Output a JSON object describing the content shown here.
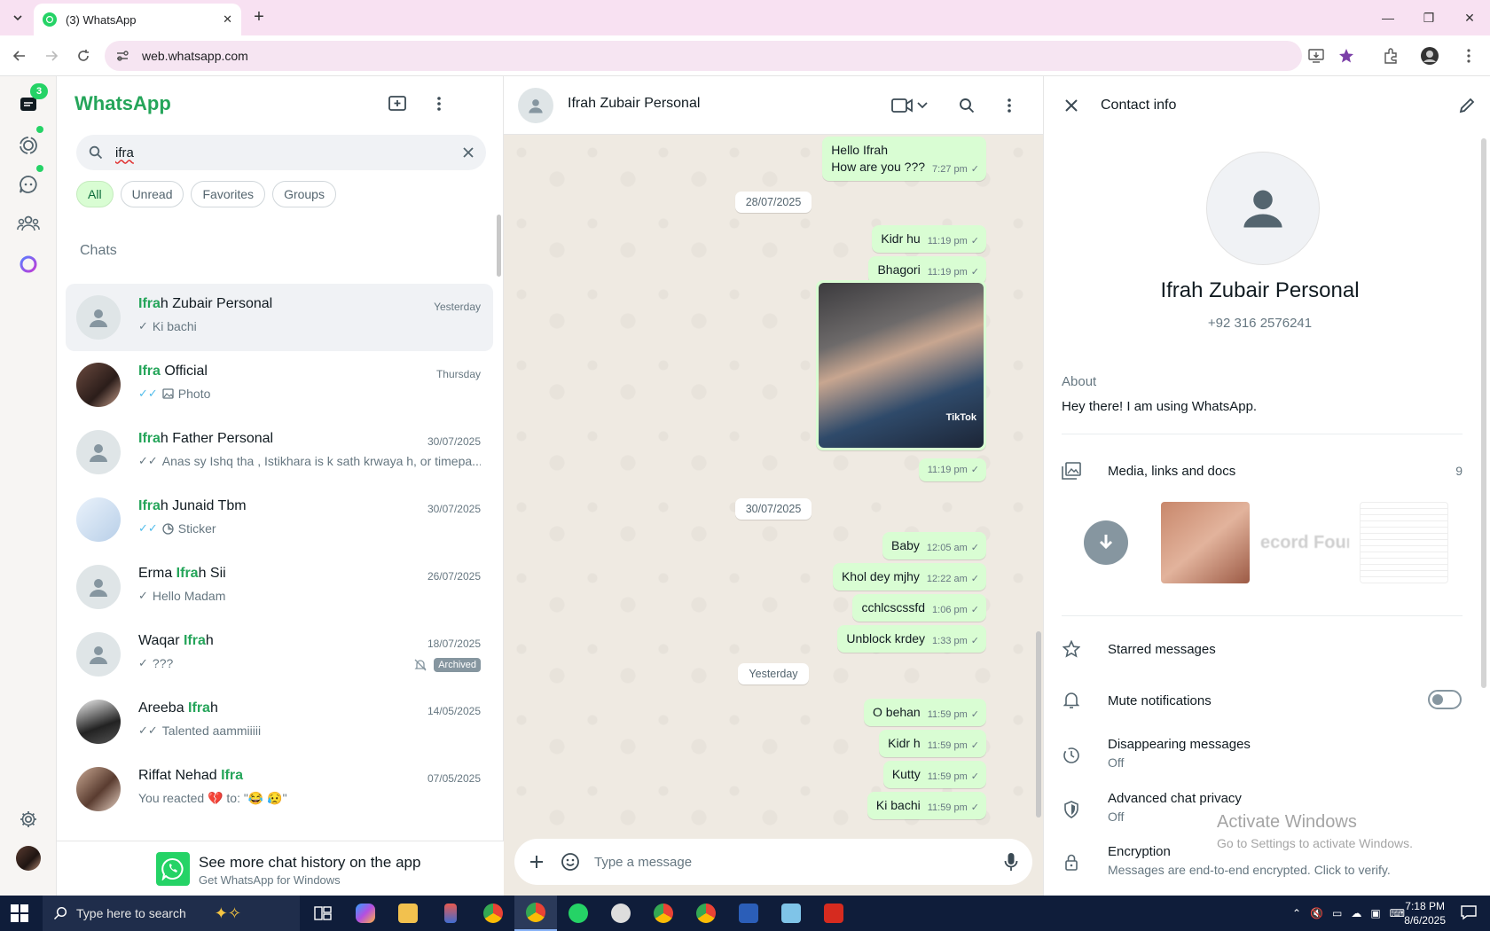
{
  "browser": {
    "tab_title": "(3) WhatsApp",
    "url": "web.whatsapp.com"
  },
  "rail": {
    "chats_badge": "3"
  },
  "sidebar": {
    "brand": "WhatsApp",
    "search_value": "ifra",
    "filters": [
      "All",
      "Unread",
      "Favorites",
      "Groups"
    ],
    "section_label": "Chats",
    "chats": [
      {
        "pre": "",
        "hl": "Ifra",
        "post": "h Zubair Personal",
        "time": "Yesterday",
        "msg": "Ki bachi",
        "tick": "✓",
        "tick_color": "grey"
      },
      {
        "pre": "",
        "hl": "Ifra",
        "post": " Official",
        "time": "Thursday",
        "msg": "Photo",
        "tick": "✓✓",
        "tick_color": "blue"
      },
      {
        "pre": "",
        "hl": "Ifra",
        "post": "h Father Personal",
        "time": "30/07/2025",
        "msg": "Anas sy Ishq tha , Istikhara is k sath krwaya h, or timepa...",
        "tick": "✓✓",
        "tick_color": "grey"
      },
      {
        "pre": "",
        "hl": "Ifra",
        "post": "h Junaid Tbm",
        "time": "30/07/2025",
        "msg": "Sticker",
        "tick": "✓✓",
        "tick_color": "blue"
      },
      {
        "pre": "Erma ",
        "hl": "Ifra",
        "post": "h Sii",
        "time": "26/07/2025",
        "msg": "Hello Madam",
        "tick": "✓",
        "tick_color": "grey"
      },
      {
        "pre": "Waqar ",
        "hl": "Ifra",
        "post": "h",
        "time": "18/07/2025",
        "msg": "???",
        "tick": "✓",
        "tick_color": "grey",
        "badge": "Archived"
      },
      {
        "pre": "Areeba ",
        "hl": "Ifra",
        "post": "h",
        "time": "14/05/2025",
        "msg": "Talented aammiiiii",
        "tick": "✓✓",
        "tick_color": "grey"
      },
      {
        "pre": "Riffat Nehad ",
        "hl": "Ifra",
        "post": "",
        "time": "07/05/2025",
        "msg": "You reacted 💔 to: \"😂 😥\"",
        "tick": "",
        "tick_color": "grey"
      }
    ],
    "promo_title": "See more chat history on the app",
    "promo_sub": "Get WhatsApp for Windows"
  },
  "conversation": {
    "contact_name": "Ifrah Zubair Personal",
    "messages": [
      {
        "kind": "text",
        "lines": [
          "Hello Ifrah",
          "How are you ???"
        ],
        "time": "7:27 pm"
      },
      {
        "kind": "date",
        "text": "28/07/2025"
      },
      {
        "kind": "text",
        "lines": [
          "Kidr hu"
        ],
        "time": "11:19 pm"
      },
      {
        "kind": "text",
        "lines": [
          "Bhagori"
        ],
        "time": "11:19 pm"
      },
      {
        "kind": "media",
        "caption": "TikTok",
        "time": "11:19 pm"
      },
      {
        "kind": "date",
        "text": "30/07/2025"
      },
      {
        "kind": "text",
        "lines": [
          "Baby"
        ],
        "time": "12:05 am"
      },
      {
        "kind": "text",
        "lines": [
          "Khol dey mjhy"
        ],
        "time": "12:22 am"
      },
      {
        "kind": "text",
        "lines": [
          "cchlcscssfd"
        ],
        "time": "1:06 pm"
      },
      {
        "kind": "text",
        "lines": [
          "Unblock krdey"
        ],
        "time": "1:33 pm"
      },
      {
        "kind": "date",
        "text": "Yesterday"
      },
      {
        "kind": "text",
        "lines": [
          "O behan"
        ],
        "time": "11:59 pm"
      },
      {
        "kind": "text",
        "lines": [
          "Kidr h"
        ],
        "time": "11:59 pm"
      },
      {
        "kind": "text",
        "lines": [
          "Kutty"
        ],
        "time": "11:59 pm"
      },
      {
        "kind": "text",
        "lines": [
          "Ki bachi"
        ],
        "time": "11:59 pm"
      }
    ],
    "compose_placeholder": "Type a message"
  },
  "contact_info": {
    "title": "Contact info",
    "name": "Ifrah Zubair Personal",
    "phone": "+92 316 2576241",
    "about_label": "About",
    "about_value": "Hey there! I am using WhatsApp.",
    "media_label": "Media, links and docs",
    "media_count": "9",
    "media_thumb_text": "ecord Foun",
    "starred_label": "Starred messages",
    "mute_label": "Mute notifications",
    "mute_on": false,
    "disappearing_label": "Disappearing messages",
    "disappearing_value": "Off",
    "privacy_label": "Advanced chat privacy",
    "privacy_value": "Off",
    "encryption_label": "Encryption",
    "encryption_value": "Messages are end-to-end encrypted. Click to verify."
  },
  "watermark": {
    "line1": "Activate Windows",
    "line2": "Go to Settings to activate Windows."
  },
  "taskbar": {
    "search_placeholder": "Type here to search",
    "time": "7:18 PM",
    "date": "8/6/2025"
  },
  "colors": {
    "accent": "#25d366",
    "brand_text": "#25a55a",
    "bubble_out": "#d9fdd3",
    "chat_bg": "#efeae2",
    "tick_blue": "#53bdeb"
  }
}
